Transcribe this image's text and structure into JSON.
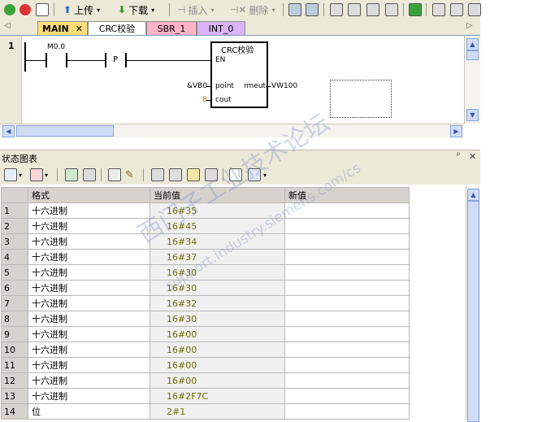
{
  "toolbar": {
    "upload": "上传",
    "download": "下载",
    "insert": "插入",
    "delete": "删除"
  },
  "tabs": [
    {
      "label": "MAIN",
      "color": "#ffde7a"
    },
    {
      "label": "CRC校验",
      "color": "#ffffff"
    },
    {
      "label": "SBR_1",
      "color": "#ffb3c7"
    },
    {
      "label": "INT_0",
      "color": "#d9b3f5"
    }
  ],
  "ladder": {
    "network": "1",
    "contact": "M0.0",
    "pos_edge": "P",
    "box_title": "CRC校验",
    "en": "EN",
    "point_param": "point",
    "point_value": "&VB0",
    "cout_param": "cout",
    "cout_value": "8",
    "out_param": "rmeut",
    "out_value": "VW100"
  },
  "status": {
    "title": "状态图表",
    "headers": [
      "",
      "格式",
      "当前值",
      "新值"
    ],
    "rows": [
      {
        "n": "1",
        "fmt": "十六进制",
        "cur": "16#35",
        "new": ""
      },
      {
        "n": "2",
        "fmt": "十六进制",
        "cur": "16#45",
        "new": ""
      },
      {
        "n": "3",
        "fmt": "十六进制",
        "cur": "16#34",
        "new": ""
      },
      {
        "n": "4",
        "fmt": "十六进制",
        "cur": "16#37",
        "new": ""
      },
      {
        "n": "5",
        "fmt": "十六进制",
        "cur": "16#30",
        "new": ""
      },
      {
        "n": "6",
        "fmt": "十六进制",
        "cur": "16#30",
        "new": ""
      },
      {
        "n": "7",
        "fmt": "十六进制",
        "cur": "16#32",
        "new": ""
      },
      {
        "n": "8",
        "fmt": "十六进制",
        "cur": "16#30",
        "new": ""
      },
      {
        "n": "9",
        "fmt": "十六进制",
        "cur": "16#00",
        "new": ""
      },
      {
        "n": "10",
        "fmt": "十六进制",
        "cur": "16#00",
        "new": ""
      },
      {
        "n": "11",
        "fmt": "十六进制",
        "cur": "16#00",
        "new": ""
      },
      {
        "n": "12",
        "fmt": "十六进制",
        "cur": "16#00",
        "new": ""
      },
      {
        "n": "13",
        "fmt": "十六进制",
        "cur": "16#2F7C",
        "new": ""
      },
      {
        "n": "14",
        "fmt": "位",
        "cur": "2#1",
        "new": ""
      }
    ]
  },
  "watermark": {
    "text1": "西门子工业技术论坛",
    "text2": "support.industry.siemens.com/cs"
  }
}
